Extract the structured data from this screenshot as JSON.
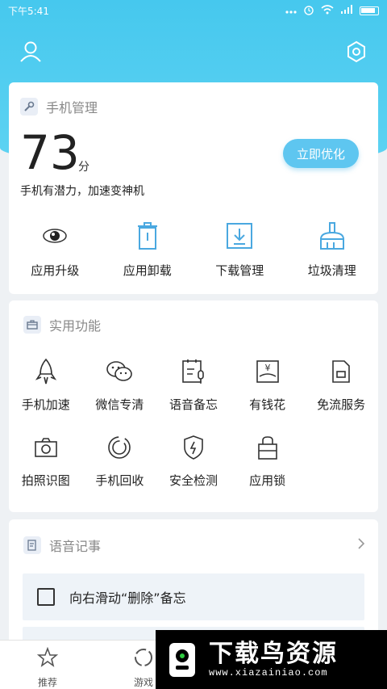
{
  "status_bar": {
    "time": "下午5:41"
  },
  "colors": {
    "accent": "#5ec6f0",
    "header_bg": "#46c8ee",
    "icon_blue": "#4aa8e0"
  },
  "phone_manager": {
    "title": "手机管理",
    "score": "73",
    "score_unit": "分",
    "description": "手机有潜力，加速变神机",
    "optimize_button": "立即优化",
    "actions": [
      {
        "label": "应用升级",
        "icon": "eye-icon"
      },
      {
        "label": "应用卸载",
        "icon": "trash-icon"
      },
      {
        "label": "下载管理",
        "icon": "download-icon"
      },
      {
        "label": "垃圾清理",
        "icon": "broom-icon"
      }
    ]
  },
  "utilities": {
    "title": "实用功能",
    "items": [
      {
        "label": "手机加速",
        "icon": "rocket-icon"
      },
      {
        "label": "微信专清",
        "icon": "wechat-icon"
      },
      {
        "label": "语音备忘",
        "icon": "voice-memo-icon"
      },
      {
        "label": "有钱花",
        "icon": "money-icon"
      },
      {
        "label": "免流服务",
        "icon": "sim-icon"
      },
      {
        "label": "拍照识图",
        "icon": "camera-icon"
      },
      {
        "label": "手机回收",
        "icon": "recycle-icon"
      },
      {
        "label": "安全检测",
        "icon": "shield-icon"
      },
      {
        "label": "应用锁",
        "icon": "lock-icon"
      }
    ]
  },
  "voice_notes": {
    "title": "语音记事",
    "items": [
      {
        "text": "向右滑动“删除”备忘"
      }
    ]
  },
  "bottom_nav": {
    "items": [
      {
        "label": "推荐",
        "icon": "star-icon"
      },
      {
        "label": "游戏",
        "icon": "game-icon"
      }
    ]
  },
  "watermark": {
    "title": "下载鸟资源",
    "url": "www.xiazainiao.com"
  }
}
